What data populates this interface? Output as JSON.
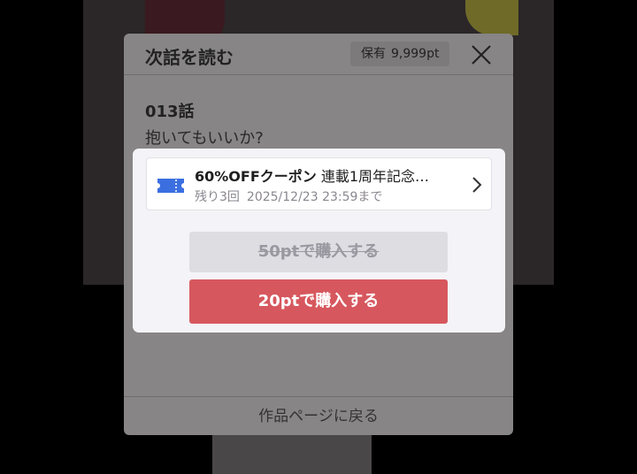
{
  "modal": {
    "title": "次話を読む",
    "points_label": "保有",
    "points_value": "9,999pt",
    "episode_number": "013話",
    "episode_title": "抱いてもいいか?",
    "footer_link": "作品ページに戻る"
  },
  "coupon": {
    "name": "60%OFFクーポン",
    "campaign": "連載1周年記念…",
    "remaining": "残り3回",
    "expiry": "2025/12/23 23:59まで",
    "icon": "ticket-icon",
    "icon_color": "#3b6fe0"
  },
  "purchase": {
    "original_price_label": "50ptで購入する",
    "discount_price_label": "20ptで購入する",
    "accent_color": "#d6585e"
  }
}
